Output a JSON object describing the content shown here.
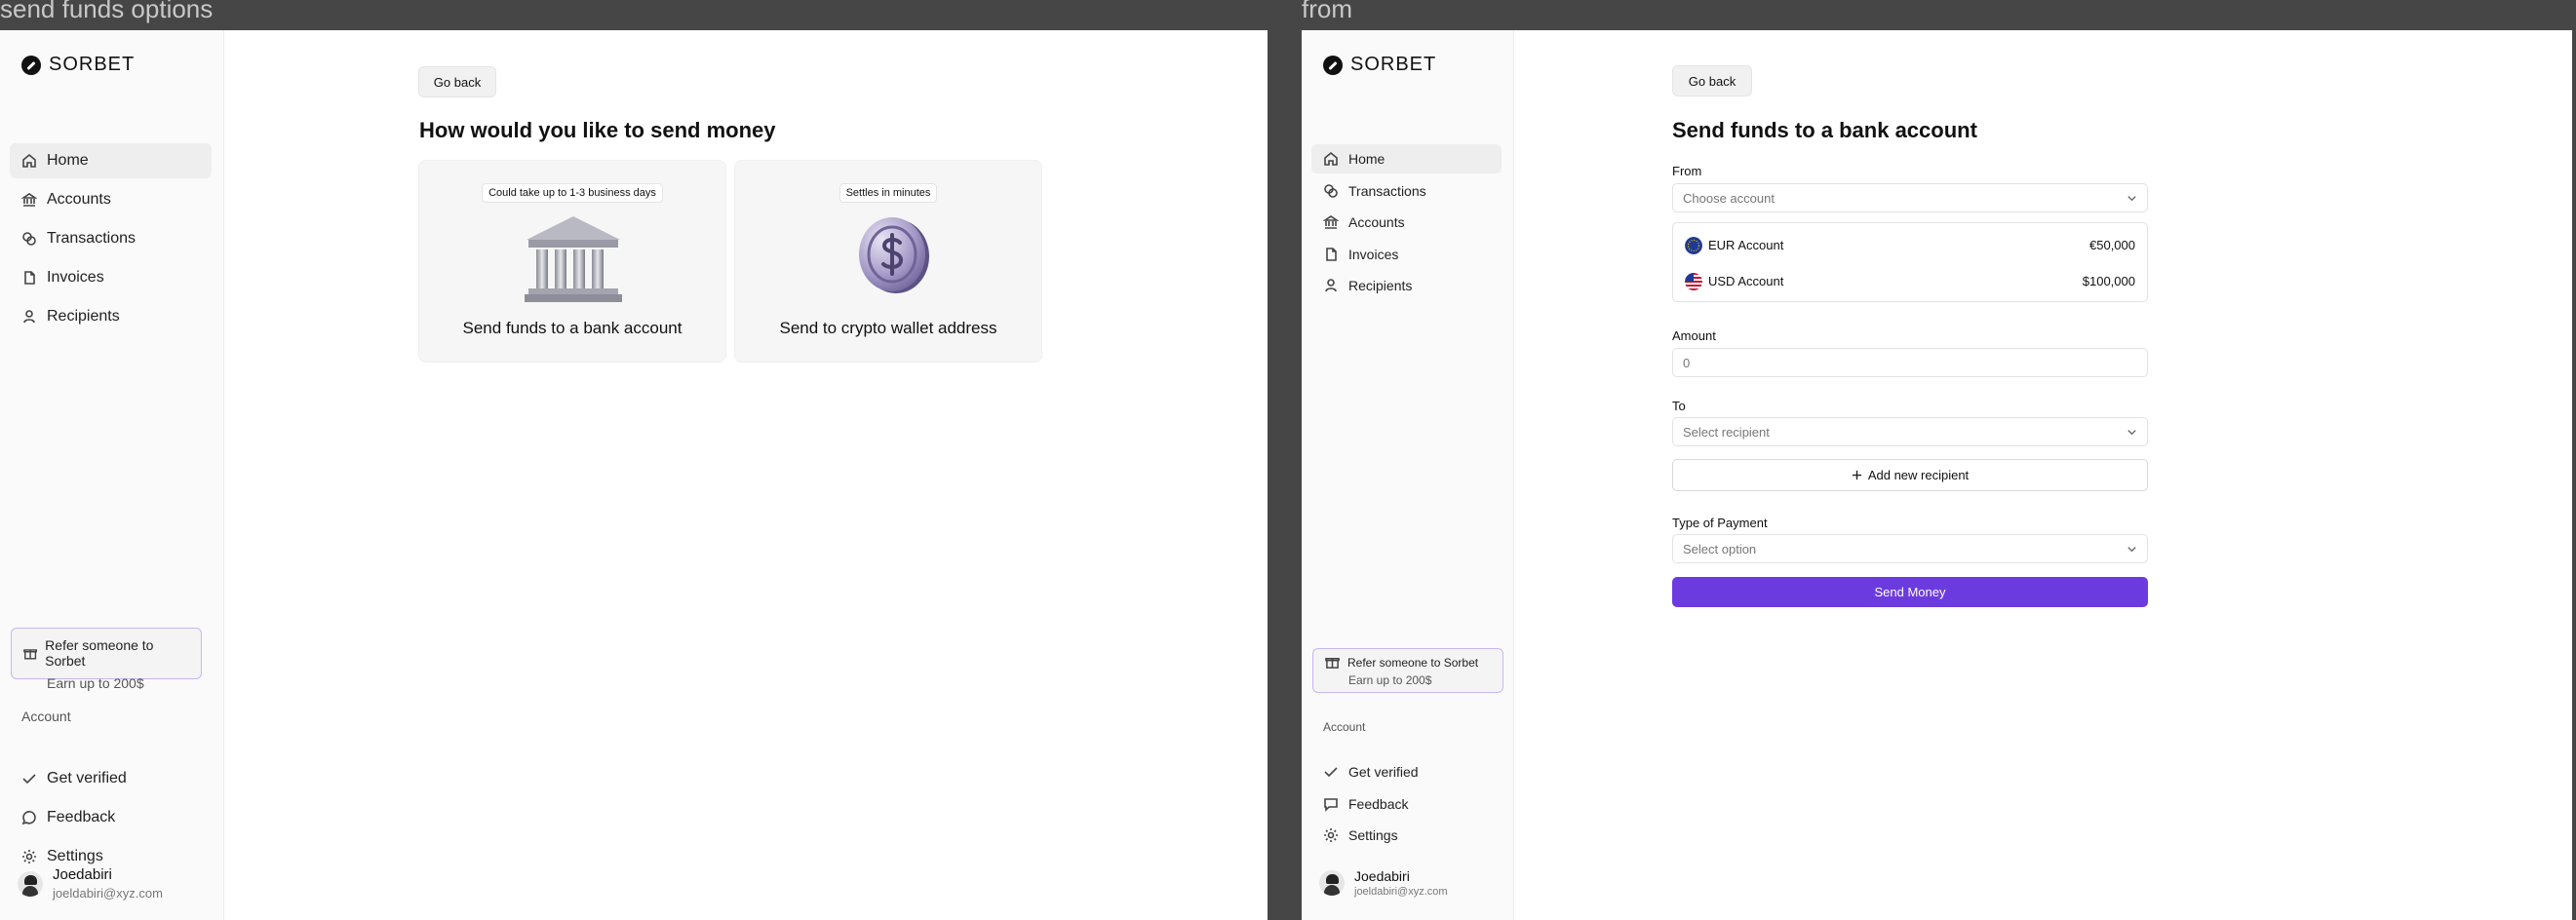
{
  "frames": {
    "a": {
      "label": "send funds options"
    },
    "b": {
      "label": "from"
    }
  },
  "brand": {
    "name": "SORBET"
  },
  "nav_a": {
    "items": [
      {
        "label": "Home",
        "icon": "home-icon"
      },
      {
        "label": "Accounts",
        "icon": "bank-icon"
      },
      {
        "label": "Transactions",
        "icon": "transactions-icon"
      },
      {
        "label": "Invoices",
        "icon": "file-icon"
      },
      {
        "label": "Recipients",
        "icon": "user-icon"
      }
    ]
  },
  "nav_b": {
    "items": [
      {
        "label": "Home",
        "icon": "home-icon"
      },
      {
        "label": "Transactions",
        "icon": "transactions-icon"
      },
      {
        "label": "Accounts",
        "icon": "bank-icon"
      },
      {
        "label": "Invoices",
        "icon": "file-icon"
      },
      {
        "label": "Recipients",
        "icon": "user-icon"
      }
    ]
  },
  "refer": {
    "title": "Refer someone to Sorbet",
    "subtitle": "Earn up to 200$"
  },
  "account_section": {
    "label": "Account",
    "items": [
      {
        "label": "Get verified",
        "icon": "check-icon"
      },
      {
        "label": "Feedback",
        "icon": "message-icon"
      },
      {
        "label": "Settings",
        "icon": "gear-icon"
      }
    ]
  },
  "user": {
    "name": "Joedabiri",
    "email": "joeldabiri@xyz.com"
  },
  "options_page": {
    "back_label": "Go back",
    "title": "How would you like to send money",
    "cards": [
      {
        "tag": "Could take up to 1-3 business days",
        "label": "Send funds to a bank account"
      },
      {
        "tag": "Settles in minutes",
        "label": "Send to crypto wallet address"
      }
    ]
  },
  "form_page": {
    "back_label": "Go back",
    "title": "Send funds to a bank account",
    "from_label": "From",
    "from_placeholder": "Choose account",
    "accounts": [
      {
        "name": "EUR Account",
        "amount": "€50,000"
      },
      {
        "name": "USD Account",
        "amount": "$100,000"
      }
    ],
    "amount_label": "Amount",
    "amount_placeholder": "0",
    "to_label": "To",
    "to_placeholder": "Select recipient",
    "add_recipient_label": "Add new recipient",
    "payment_type_label": "Type of Payment",
    "payment_type_placeholder": "Select option",
    "send_label": "Send Money"
  },
  "colors": {
    "accent": "#6c3be0",
    "frame_bg": "#464646",
    "refer_border": "#c8b6f0"
  }
}
